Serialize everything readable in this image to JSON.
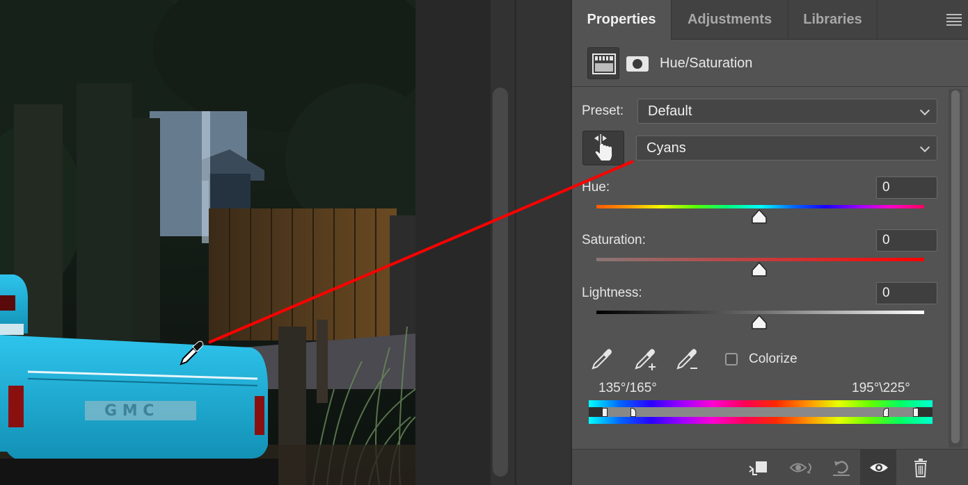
{
  "tabs": [
    {
      "label": "Properties",
      "active": true
    },
    {
      "label": "Adjustments",
      "active": false
    },
    {
      "label": "Libraries",
      "active": false
    }
  ],
  "header": {
    "title": "Hue/Saturation"
  },
  "preset": {
    "label": "Preset:",
    "value": "Default"
  },
  "channel": {
    "value": "Cyans"
  },
  "hue": {
    "label": "Hue:",
    "value": "0"
  },
  "saturation": {
    "label": "Saturation:",
    "value": "0"
  },
  "lightness": {
    "label": "Lightness:",
    "value": "0"
  },
  "colorize": {
    "label": "Colorize",
    "checked": false
  },
  "range": {
    "left": "135°/165°",
    "right": "195°\\225°"
  },
  "icons": {
    "panel_menu": "hamburger-menu-icon",
    "adjustment": "hue-saturation-adjustment-icon",
    "mask": "layer-mask-icon",
    "targeted_adjustment": "targeted-adjustment-hand-icon",
    "eyedroppers": [
      "eyedropper-icon",
      "add-to-sample-eyedropper-icon",
      "subtract-from-sample-eyedropper-icon"
    ],
    "footer": [
      "clip-to-layer-icon",
      "view-previous-state-icon",
      "reset-icon",
      "visibility-eye-icon",
      "delete-trash-icon"
    ]
  },
  "colors": {
    "annotation_line": "#ff0000",
    "panel_bg": "#535353",
    "truck": "#1fb8e0"
  }
}
